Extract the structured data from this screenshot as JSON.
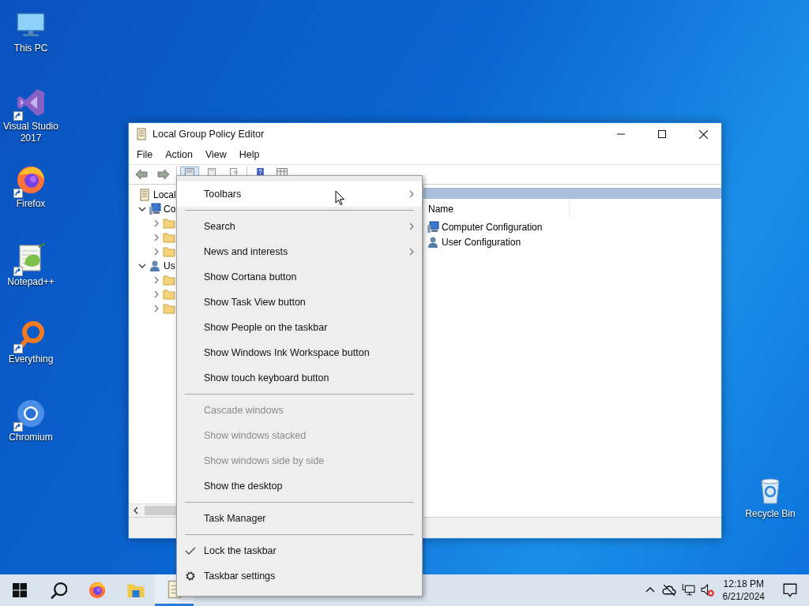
{
  "desktop_icons": [
    {
      "label": "This PC",
      "shortcut": false
    },
    {
      "label": "Visual Studio 2017",
      "shortcut": true
    },
    {
      "label": "Firefox",
      "shortcut": true
    },
    {
      "label": "Notepad++",
      "shortcut": true
    },
    {
      "label": "Everything",
      "shortcut": true
    },
    {
      "label": "Chromium",
      "shortcut": true
    }
  ],
  "recycle_bin": {
    "label": "Recycle Bin"
  },
  "window": {
    "title": "Local Group Policy Editor",
    "menu": [
      "File",
      "Action",
      "View",
      "Help"
    ],
    "tree": [
      {
        "label": "Local",
        "children": [
          {
            "label": "Co",
            "expanded": true,
            "children": [
              {
                "expanded": false
              },
              {
                "expanded": false
              },
              {
                "expanded": false
              }
            ]
          },
          {
            "label": "Us",
            "expanded": true,
            "children": [
              {
                "expanded": false
              },
              {
                "expanded": false
              },
              {
                "expanded": false
              }
            ]
          }
        ]
      }
    ],
    "list": {
      "columns": [
        "Name"
      ],
      "rows": [
        "Computer Configuration",
        "User Configuration"
      ]
    }
  },
  "context_menu": [
    {
      "kind": "entry",
      "label": "Toolbars",
      "selected": true,
      "submenu": true,
      "disabled": false,
      "checked": false
    },
    {
      "kind": "separator"
    },
    {
      "kind": "entry",
      "label": "Search",
      "selected": false,
      "submenu": true,
      "disabled": false,
      "checked": false
    },
    {
      "kind": "entry",
      "label": "News and interests",
      "selected": false,
      "submenu": true,
      "disabled": false,
      "checked": false
    },
    {
      "kind": "entry",
      "label": "Show Cortana button",
      "selected": false,
      "submenu": false,
      "disabled": false,
      "checked": false
    },
    {
      "kind": "entry",
      "label": "Show Task View button",
      "selected": false,
      "submenu": false,
      "disabled": false,
      "checked": false
    },
    {
      "kind": "entry",
      "label": "Show People on the taskbar",
      "selected": false,
      "submenu": false,
      "disabled": false,
      "checked": false
    },
    {
      "kind": "entry",
      "label": "Show Windows Ink Workspace button",
      "selected": false,
      "submenu": false,
      "disabled": false,
      "checked": false
    },
    {
      "kind": "entry",
      "label": "Show touch keyboard button",
      "selected": false,
      "submenu": false,
      "disabled": false,
      "checked": false
    },
    {
      "kind": "separator"
    },
    {
      "kind": "entry",
      "label": "Cascade windows",
      "selected": false,
      "submenu": false,
      "disabled": true,
      "checked": false
    },
    {
      "kind": "entry",
      "label": "Show windows stacked",
      "selected": false,
      "submenu": false,
      "disabled": true,
      "checked": false
    },
    {
      "kind": "entry",
      "label": "Show windows side by side",
      "selected": false,
      "submenu": false,
      "disabled": true,
      "checked": false
    },
    {
      "kind": "entry",
      "label": "Show the desktop",
      "selected": false,
      "submenu": false,
      "disabled": false,
      "checked": false
    },
    {
      "kind": "separator"
    },
    {
      "kind": "entry",
      "label": "Task Manager",
      "selected": false,
      "submenu": false,
      "disabled": false,
      "checked": false
    },
    {
      "kind": "separator"
    },
    {
      "kind": "entry",
      "label": "Lock the taskbar",
      "selected": false,
      "submenu": false,
      "disabled": false,
      "checked": true
    },
    {
      "kind": "settings",
      "label": "Taskbar settings",
      "selected": false,
      "submenu": false,
      "disabled": false,
      "checked": false
    }
  ],
  "taskbar": {
    "apps": [
      {
        "active": false
      },
      {
        "active": false
      },
      {
        "active": false
      },
      {
        "active": false
      },
      {
        "active": true
      }
    ],
    "clock": {
      "time": "12:18 PM",
      "date": "6/21/2024"
    }
  }
}
